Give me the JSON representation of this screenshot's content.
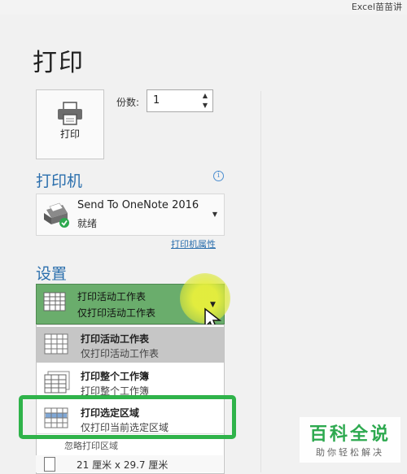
{
  "window_title": "Excel苗苗讲",
  "page_title": "打印",
  "print_button": {
    "label": "打印"
  },
  "copies": {
    "label": "份数:",
    "value": "1"
  },
  "printer_section": {
    "title": "打印机",
    "printer_name": "Send To OneNote 2016",
    "printer_status": "就绪",
    "properties_link": "打印机属性"
  },
  "settings_section": {
    "title": "设置",
    "selected": {
      "title": "打印活动工作表",
      "desc": "仅打印活动工作表"
    },
    "options": [
      {
        "title": "打印活动工作表",
        "desc": "仅打印活动工作表"
      },
      {
        "title": "打印整个工作簿",
        "desc": "打印整个工作簿"
      },
      {
        "title": "打印选定区域",
        "desc": "仅打印当前选定区域"
      }
    ],
    "ignore_print_area": "忽略打印区域",
    "paper_size": "21 厘米 x 29.7 厘米"
  },
  "watermark": {
    "title": "百科全说",
    "subtitle": "助你轻松解决"
  },
  "colors": {
    "accent": "#2b6fad",
    "selection_green": "#6aad6c",
    "highlight_frame": "#2fb34a"
  },
  "icons": [
    "printer-icon",
    "spreadsheet-icon",
    "chevron-down-icon",
    "info-icon",
    "mouse-cursor-icon",
    "check-badge-icon"
  ]
}
